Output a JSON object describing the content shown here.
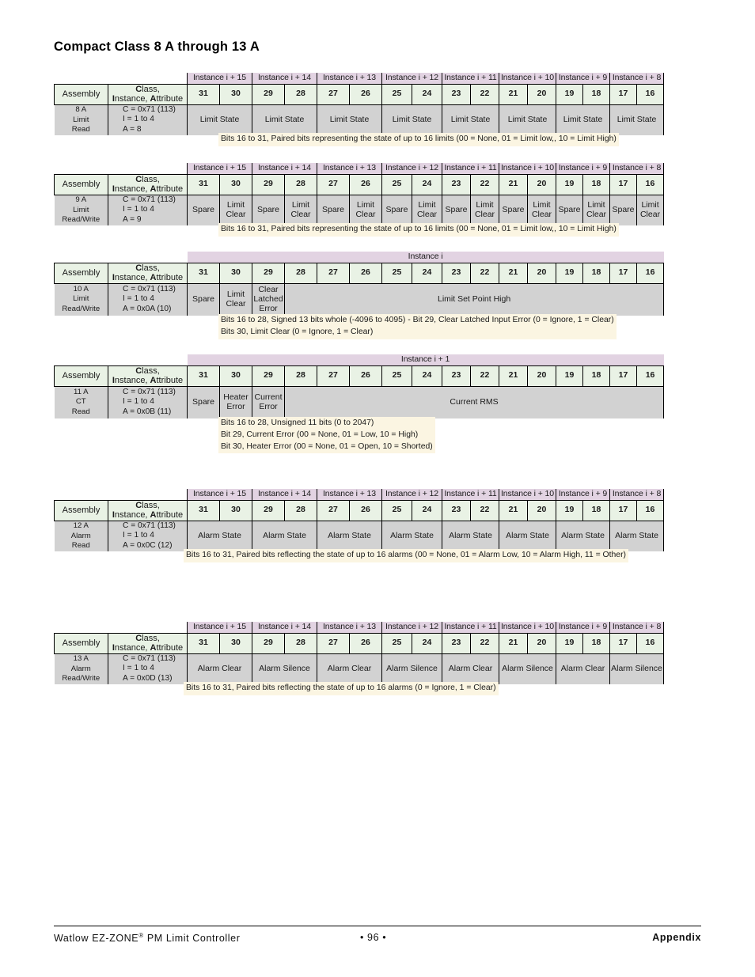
{
  "page": {
    "title": "Compact Class 8 A through 13 A"
  },
  "labels": {
    "assembly": "Assembly",
    "cia_line1_bold": "C",
    "cia_line1_rest": "lass,",
    "cia_line2": "Instance, Attribute",
    "cia_full": "Class, Instance, Attribute"
  },
  "tables": [
    {
      "id": "8A",
      "assembly": [
        "8 A",
        "Limit",
        "Read"
      ],
      "cia": [
        "C = 0x71 (113)",
        "I = 1 to 4",
        "A = 8"
      ],
      "instances": [
        {
          "label": "Instance i + 15",
          "span": 2
        },
        {
          "label": "Instance i + 14",
          "span": 2
        },
        {
          "label": "Instance i + 13",
          "span": 2
        },
        {
          "label": "Instance i + 12",
          "span": 2
        },
        {
          "label": "Instance i + 11",
          "span": 2
        },
        {
          "label": "Instance i + 10",
          "span": 2
        },
        {
          "label": "Instance i + 9",
          "span": 2
        },
        {
          "label": "Instance i + 8",
          "span": 2
        }
      ],
      "bits": [
        "31",
        "30",
        "29",
        "28",
        "27",
        "26",
        "25",
        "24",
        "23",
        "22",
        "21",
        "20",
        "19",
        "18",
        "17",
        "16"
      ],
      "cells": [
        {
          "label": "Limit State",
          "span": 2
        },
        {
          "label": "Limit State",
          "span": 2
        },
        {
          "label": "Limit State",
          "span": 2
        },
        {
          "label": "Limit State",
          "span": 2
        },
        {
          "label": "Limit State",
          "span": 2
        },
        {
          "label": "Limit State",
          "span": 2
        },
        {
          "label": "Limit State",
          "span": 2
        },
        {
          "label": "Limit State",
          "span": 2
        }
      ],
      "notes": [
        "Bits 16 to 31, Paired bits representing the state of up to 16 limits (00 = None, 01 = Limit low,, 10 = Limit High)"
      ]
    },
    {
      "id": "9A",
      "assembly": [
        "9 A",
        "Limit",
        "Read/Write"
      ],
      "cia": [
        "C = 0x71 (113)",
        "I = 1 to 4",
        "A = 9"
      ],
      "instances": [
        {
          "label": "Instance i + 15",
          "span": 2
        },
        {
          "label": "Instance i + 14",
          "span": 2
        },
        {
          "label": "Instance i + 13",
          "span": 2
        },
        {
          "label": "Instance i + 12",
          "span": 2
        },
        {
          "label": "Instance i + 11",
          "span": 2
        },
        {
          "label": "Instance i + 10",
          "span": 2
        },
        {
          "label": "Instance i + 9",
          "span": 2
        },
        {
          "label": "Instance i + 8",
          "span": 2
        }
      ],
      "bits": [
        "31",
        "30",
        "29",
        "28",
        "27",
        "26",
        "25",
        "24",
        "23",
        "22",
        "21",
        "20",
        "19",
        "18",
        "17",
        "16"
      ],
      "cells": [
        {
          "label": "Spare",
          "span": 1
        },
        {
          "label": "Limit Clear",
          "span": 1
        },
        {
          "label": "Spare",
          "span": 1
        },
        {
          "label": "Limit Clear",
          "span": 1
        },
        {
          "label": "Spare",
          "span": 1
        },
        {
          "label": "Limit Clear",
          "span": 1
        },
        {
          "label": "Spare",
          "span": 1
        },
        {
          "label": "Limit Clear",
          "span": 1
        },
        {
          "label": "Spare",
          "span": 1
        },
        {
          "label": "Limit Clear",
          "span": 1
        },
        {
          "label": "Spare",
          "span": 1
        },
        {
          "label": "Limit Clear",
          "span": 1
        },
        {
          "label": "Spare",
          "span": 1
        },
        {
          "label": "Limit Clear",
          "span": 1
        },
        {
          "label": "Spare",
          "span": 1
        },
        {
          "label": "Limit Clear",
          "span": 1
        }
      ],
      "notes": [
        "Bits 16 to 31, Paired bits representing the state of up to 16 limits (00 = None, 01 = Limit low,, 10 = Limit High)"
      ]
    },
    {
      "id": "10A",
      "assembly": [
        "10 A",
        "Limit",
        "Read/Write"
      ],
      "cia": [
        "C = 0x71 (113)",
        "I = 1 to 4",
        "A = 0x0A (10)"
      ],
      "instances": [
        {
          "label": "Instance i",
          "span": 16
        }
      ],
      "bits": [
        "31",
        "30",
        "29",
        "28",
        "27",
        "26",
        "25",
        "24",
        "23",
        "22",
        "21",
        "20",
        "19",
        "18",
        "17",
        "16"
      ],
      "cells": [
        {
          "label": "Spare",
          "span": 1
        },
        {
          "label": "Limit Clear",
          "span": 1
        },
        {
          "label": "Clear Latched Error",
          "span": 1
        },
        {
          "label": "Limit Set Point High",
          "span": 13
        }
      ],
      "notes": [
        "Bits 16 to 28, Signed 13 bits whole (-4096 to 4095) - Bit 29, Clear Latched Input Error (0 = Ignore, 1 = Clear)",
        "Bits 30, Limit Clear (0 = Ignore, 1 = Clear)"
      ]
    },
    {
      "id": "11A",
      "assembly": [
        "11 A",
        "CT",
        "Read"
      ],
      "cia": [
        "C = 0x71 (113)",
        "I = 1 to 4",
        "A = 0x0B (11)"
      ],
      "instances": [
        {
          "label": "Instance i + 1",
          "span": 16
        }
      ],
      "bits": [
        "31",
        "30",
        "29",
        "28",
        "27",
        "26",
        "25",
        "24",
        "23",
        "22",
        "21",
        "20",
        "19",
        "18",
        "17",
        "16"
      ],
      "cells": [
        {
          "label": "Spare",
          "span": 1
        },
        {
          "label": "Heater Error",
          "span": 1
        },
        {
          "label": "Current Error",
          "span": 1
        },
        {
          "label": "Current RMS",
          "span": 13
        }
      ],
      "notes": [
        "Bits 16 to 28, Unsigned 11 bits (0 to 2047)",
        "Bit 29, Current Error (00 = None, 01 = Low, 10 = High)",
        "Bit 30, Heater Error (00 = None, 01 = Open, 10 = Shorted)"
      ]
    },
    {
      "id": "12A",
      "assembly": [
        "12 A",
        "Alarm",
        "Read"
      ],
      "cia": [
        "C = 0x71 (113)",
        "I = 1 to 4",
        "A = 0x0C (12)"
      ],
      "instances": [
        {
          "label": "Instance i + 15",
          "span": 2
        },
        {
          "label": "Instance i + 14",
          "span": 2
        },
        {
          "label": "Instance i + 13",
          "span": 2
        },
        {
          "label": "Instance i + 12",
          "span": 2
        },
        {
          "label": "Instance i + 11",
          "span": 2
        },
        {
          "label": "Instance i + 10",
          "span": 2
        },
        {
          "label": "Instance i + 9",
          "span": 2
        },
        {
          "label": "Instance i + 8",
          "span": 2
        }
      ],
      "bits": [
        "31",
        "30",
        "29",
        "28",
        "27",
        "26",
        "25",
        "24",
        "23",
        "22",
        "21",
        "20",
        "19",
        "18",
        "17",
        "16"
      ],
      "cells": [
        {
          "label": "Alarm State",
          "span": 2
        },
        {
          "label": "Alarm State",
          "span": 2
        },
        {
          "label": "Alarm State",
          "span": 2
        },
        {
          "label": "Alarm State",
          "span": 2
        },
        {
          "label": "Alarm State",
          "span": 2
        },
        {
          "label": "Alarm State",
          "span": 2
        },
        {
          "label": "Alarm State",
          "span": 2
        },
        {
          "label": "Alarm State",
          "span": 2
        }
      ],
      "notes": [
        "Bits 16 to 31, Paired bits reflecting the state of up to 16 alarms (00 = None, 01 = Alarm Low, 10 = Alarm High, 11 = Other)"
      ]
    },
    {
      "id": "13A",
      "assembly": [
        "13 A",
        "Alarm",
        "Read/Write"
      ],
      "cia": [
        "C = 0x71 (113)",
        "I = 1 to 4",
        "A = 0x0D (13)"
      ],
      "instances": [
        {
          "label": "Instance i + 15",
          "span": 2
        },
        {
          "label": "Instance i + 14",
          "span": 2
        },
        {
          "label": "Instance i + 13",
          "span": 2
        },
        {
          "label": "Instance i + 12",
          "span": 2
        },
        {
          "label": "Instance i + 11",
          "span": 2
        },
        {
          "label": "Instance i + 10",
          "span": 2
        },
        {
          "label": "Instance i + 9",
          "span": 2
        },
        {
          "label": "Instance i + 8",
          "span": 2
        }
      ],
      "bits": [
        "31",
        "30",
        "29",
        "28",
        "27",
        "26",
        "25",
        "24",
        "23",
        "22",
        "21",
        "20",
        "19",
        "18",
        "17",
        "16"
      ],
      "cells": [
        {
          "label": "Alarm Clear",
          "span": 2
        },
        {
          "label": "Alarm Silence",
          "span": 2
        },
        {
          "label": "Alarm Clear",
          "span": 2
        },
        {
          "label": "Alarm Silence",
          "span": 2
        },
        {
          "label": "Alarm Clear",
          "span": 2
        },
        {
          "label": "Alarm Silence",
          "span": 2
        },
        {
          "label": "Alarm Clear",
          "span": 2
        },
        {
          "label": "Alarm Silence",
          "span": 2
        }
      ],
      "notes": [
        "Bits 16 to 31, Paired bits reflecting the state of up to 16 alarms (0 = Ignore, 1 = Clear)"
      ]
    }
  ],
  "footer": {
    "left_prefix": "Watlow EZ-ZONE",
    "left_sup": "®",
    "left_suffix": " PM Limit Controller",
    "page_number": "• 96 •",
    "right": "Appendix"
  },
  "colors": {
    "instance_band": "#e2d3e2",
    "bit_header": "#e9f2e5",
    "body_row": "#d2d2d2",
    "note_bg": "#fbf5e2",
    "text": "#1a1a1a"
  }
}
